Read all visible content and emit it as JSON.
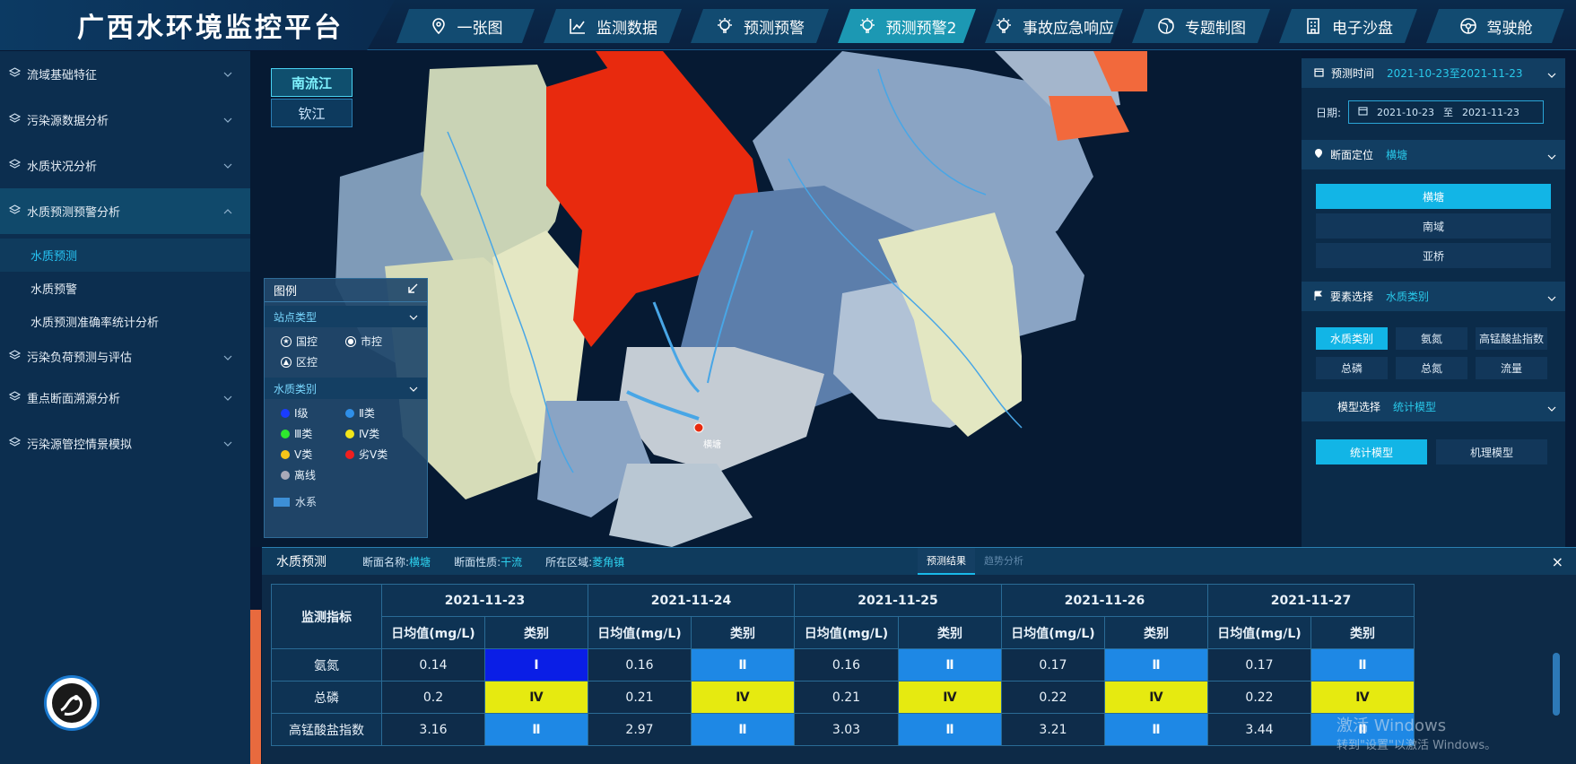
{
  "app_title": "广西水环境监控平台",
  "nav": [
    {
      "label": "一张图",
      "icon": "map-pin-icon"
    },
    {
      "label": "监测数据",
      "icon": "line-chart-icon"
    },
    {
      "label": "预测预警",
      "icon": "bulb-icon"
    },
    {
      "label": "预测预警2",
      "icon": "bulb-icon",
      "active": true
    },
    {
      "label": "事故应急响应",
      "icon": "bulb-icon"
    },
    {
      "label": "专题制图",
      "icon": "globe-icon"
    },
    {
      "label": "电子沙盘",
      "icon": "building-icon"
    },
    {
      "label": "驾驶舱",
      "icon": "steering-icon"
    }
  ],
  "sidebar": {
    "items": [
      "流域基础特征",
      "污染源数据分析",
      "水质状况分析",
      "水质预测预警分析"
    ],
    "sub_items": [
      "水质预测",
      "水质预警",
      "水质预测准确率统计分析"
    ],
    "items_after": [
      "污染负荷预测与评估",
      "重点断面溯源分析",
      "污染源管控情景模拟"
    ]
  },
  "river_tabs": [
    "南流江",
    "钦江"
  ],
  "map": {
    "station_label": "横塘"
  },
  "legend": {
    "title": "图例",
    "station_type_title": "站点类型",
    "station_types": [
      "国控",
      "市控",
      "区控"
    ],
    "quality_title": "水质类别",
    "quality_classes": [
      {
        "label": "Ⅰ级",
        "color": "#1a3cff"
      },
      {
        "label": "Ⅱ类",
        "color": "#2f8fe8"
      },
      {
        "label": "Ⅲ类",
        "color": "#2ee82e"
      },
      {
        "label": "Ⅳ类",
        "color": "#f2e61a"
      },
      {
        "label": "Ⅴ类",
        "color": "#f5c518"
      },
      {
        "label": "劣Ⅴ类",
        "color": "#f01f1f"
      },
      {
        "label": "离线",
        "color": "#a9a9b8"
      }
    ],
    "water_label": "水系"
  },
  "right_panel": {
    "forecast_time_label": "预测时间",
    "forecast_time_value": "2021-10-23至2021-11-23",
    "date_label": "日期:",
    "date_start": "2021-10-23",
    "date_sep": "至",
    "date_end": "2021-11-23",
    "section_label": "断面定位",
    "section_value": "横塘",
    "sections": [
      "横塘",
      "南域",
      "亚桥"
    ],
    "element_label": "要素选择",
    "element_value": "水质类别",
    "elements": [
      "水质类别",
      "氨氮",
      "高锰酸盐指数",
      "总磷",
      "总氮",
      "流量"
    ],
    "model_label": "模型选择",
    "model_value": "统计模型",
    "models": [
      "统计模型",
      "机理模型"
    ]
  },
  "bottom_panel": {
    "title": "水质预测",
    "section_name_label": "断面名称:",
    "section_name": "横塘",
    "section_nature_label": "断面性质:",
    "section_nature": "干流",
    "region_label": "所在区域:",
    "region": "菱角镇",
    "tabs": [
      "预测结果",
      "趋势分析"
    ],
    "close": "×",
    "table": {
      "index_header": "监测指标",
      "dates": [
        "2021-11-23",
        "2021-11-24",
        "2021-11-25",
        "2021-11-26",
        "2021-11-27"
      ],
      "sub_headers": [
        "日均值(mg/L)",
        "类别"
      ],
      "rows": [
        {
          "name": "氨氮",
          "values": [
            "0.14",
            "0.16",
            "0.16",
            "0.17",
            "0.17"
          ],
          "classes": [
            "Ⅰ",
            "Ⅱ",
            "Ⅱ",
            "Ⅱ",
            "Ⅱ"
          ]
        },
        {
          "name": "总磷",
          "values": [
            "0.2",
            "0.21",
            "0.21",
            "0.22",
            "0.22"
          ],
          "classes": [
            "Ⅳ",
            "Ⅳ",
            "Ⅳ",
            "Ⅳ",
            "Ⅳ"
          ]
        },
        {
          "name": "高锰酸盐指数",
          "values": [
            "3.16",
            "2.97",
            "3.03",
            "3.21",
            "3.44"
          ],
          "classes": [
            "Ⅱ",
            "Ⅱ",
            "Ⅱ",
            "Ⅱ",
            "Ⅱ"
          ]
        }
      ],
      "class_colors": {
        "Ⅰ": "#0a1ee6",
        "Ⅱ": "#1e88e5",
        "Ⅳ": "#e6ea10"
      }
    }
  },
  "watermark": {
    "line1": "激活 Windows",
    "line2": "转到\"设置\"以激活 Windows。"
  }
}
